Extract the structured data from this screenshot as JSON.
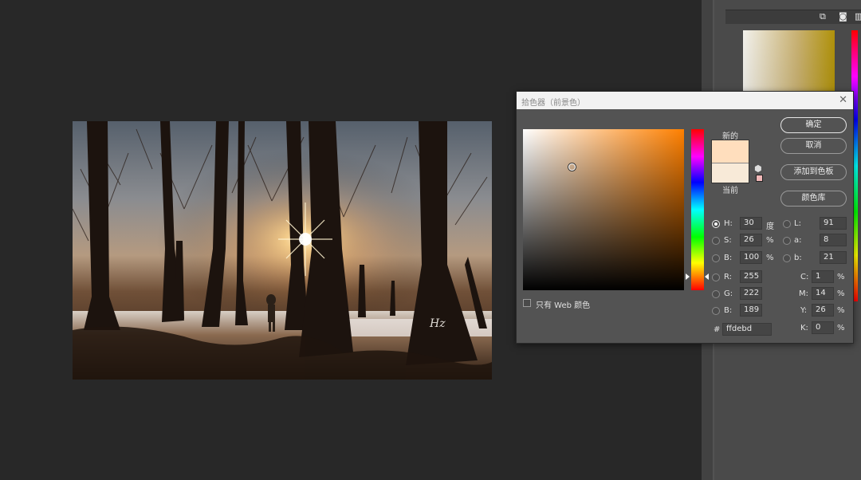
{
  "picker": {
    "title": "拾色器（前景色）",
    "close_glyph": "✕",
    "new_label": "新的",
    "current_label": "当前",
    "buttons": {
      "ok": "确定",
      "cancel": "取消",
      "add_swatch": "添加到色板",
      "library": "颜色库"
    },
    "web_only_label": "只有 Web 颜色",
    "hsb": [
      {
        "key": "H:",
        "value": "30",
        "unit": "度",
        "checked": true
      },
      {
        "key": "S:",
        "value": "26",
        "unit": "%",
        "checked": false
      },
      {
        "key": "B:",
        "value": "100",
        "unit": "%",
        "checked": false
      }
    ],
    "rgb": [
      {
        "key": "R:",
        "value": "255"
      },
      {
        "key": "G:",
        "value": "222"
      },
      {
        "key": "B:",
        "value": "189"
      }
    ],
    "lab": [
      {
        "key": "L:",
        "value": "91"
      },
      {
        "key": "a:",
        "value": "8"
      },
      {
        "key": "b:",
        "value": "21"
      }
    ],
    "cmyk": [
      {
        "key": "C:",
        "value": "1",
        "unit": "%"
      },
      {
        "key": "M:",
        "value": "14",
        "unit": "%"
      },
      {
        "key": "Y:",
        "value": "26",
        "unit": "%"
      },
      {
        "key": "K:",
        "value": "0",
        "unit": "%"
      }
    ],
    "hex_label": "#",
    "hex_value": "ffdebd",
    "colors": {
      "new": "#ffdebd",
      "current": "#f8ead8",
      "hue_base": "#ff8000",
      "web_safe_warning": "#f2b8b8"
    }
  },
  "photo": {
    "watermark": "Hz"
  },
  "dock": {
    "icons": [
      "layers-add-icon",
      "camera-icon",
      "trash-icon"
    ],
    "icon_glyphs": [
      "⧉",
      "◙",
      "▥"
    ]
  }
}
